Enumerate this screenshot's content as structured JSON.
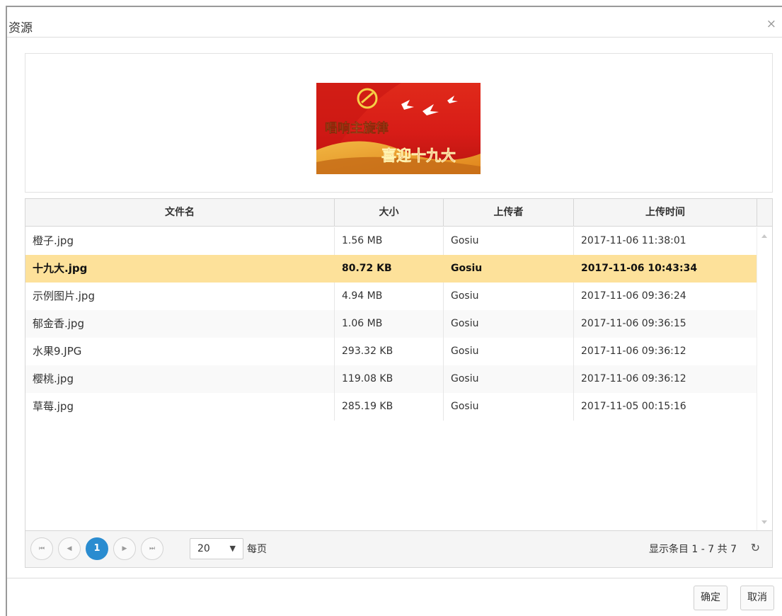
{
  "dialog": {
    "title": "资源",
    "close_glyph": "×"
  },
  "preview": {
    "banner_line1": "唱响主旋律",
    "banner_line2": "喜迎十九大",
    "colors": {
      "red": "#d8201a",
      "gold": "#f2b320"
    }
  },
  "grid": {
    "columns": [
      "文件名",
      "大小",
      "上传者",
      "上传时间"
    ],
    "rows": [
      {
        "name": "橙子.jpg",
        "size": "1.56 MB",
        "uploader": "Gosiu",
        "time": "2017-11-06 11:38:01"
      },
      {
        "name": "十九大.jpg",
        "size": "80.72 KB",
        "uploader": "Gosiu",
        "time": "2017-11-06 10:43:34"
      },
      {
        "name": "示例图片.jpg",
        "size": "4.94 MB",
        "uploader": "Gosiu",
        "time": "2017-11-06 09:36:24"
      },
      {
        "name": "郁金香.jpg",
        "size": "1.06 MB",
        "uploader": "Gosiu",
        "time": "2017-11-06 09:36:15"
      },
      {
        "name": "水果9.JPG",
        "size": "293.32 KB",
        "uploader": "Gosiu",
        "time": "2017-11-06 09:36:12"
      },
      {
        "name": "樱桃.jpg",
        "size": "119.08 KB",
        "uploader": "Gosiu",
        "time": "2017-11-06 09:36:12"
      },
      {
        "name": "草莓.jpg",
        "size": "285.19 KB",
        "uploader": "Gosiu",
        "time": "2017-11-05 00:15:16"
      }
    ],
    "selected_row": 1
  },
  "pager": {
    "first_glyph": "⏮",
    "prev_glyph": "◀",
    "current_page": "1",
    "next_glyph": "▶",
    "last_glyph": "⏭",
    "page_size": "20",
    "page_size_caret": "▼",
    "per_page_label": "每页",
    "info": "显示条目 1 - 7 共 7",
    "refresh_glyph": "↻"
  },
  "footer": {
    "ok_label": "确定",
    "cancel_label": "取消"
  }
}
